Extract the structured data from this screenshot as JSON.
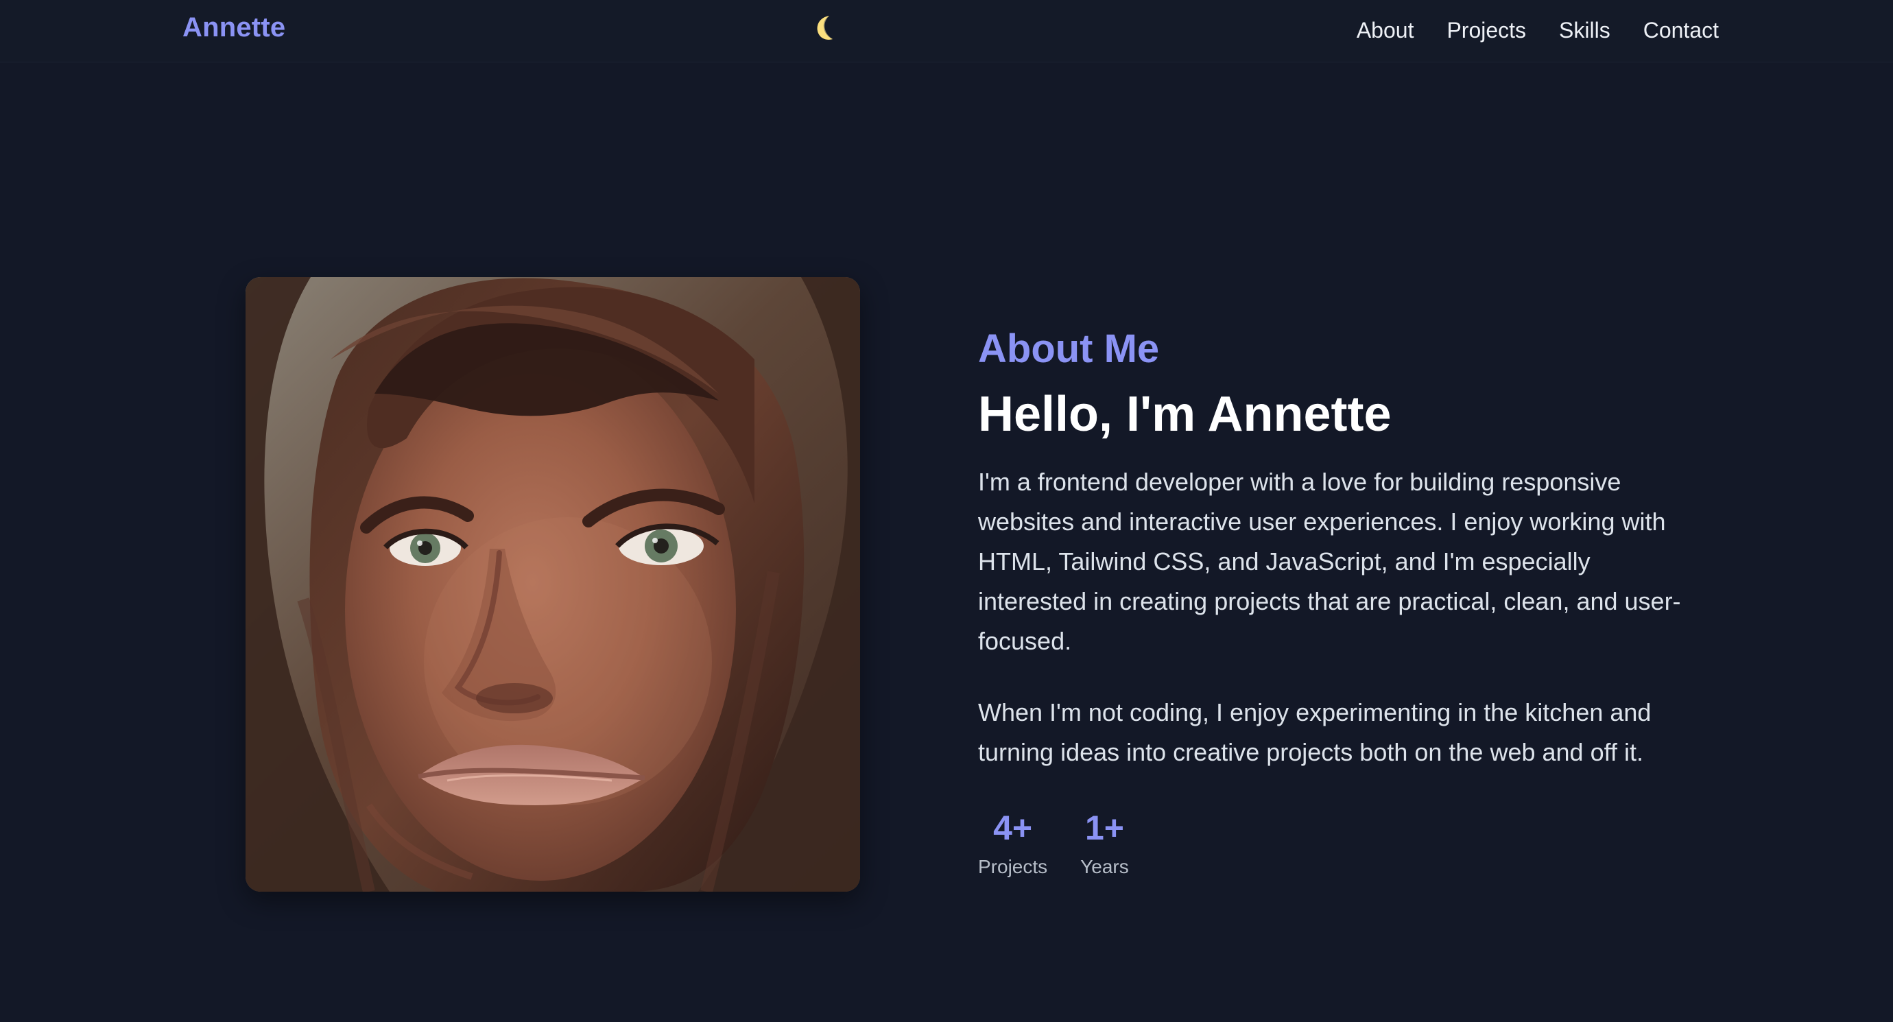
{
  "nav": {
    "brand": "Annette",
    "theme_icon": "moon-icon",
    "links": [
      {
        "label": "About"
      },
      {
        "label": "Projects"
      },
      {
        "label": "Skills"
      },
      {
        "label": "Contact"
      }
    ]
  },
  "about": {
    "section_title": "About Me",
    "headline": "Hello, I'm Annette",
    "paragraphs": [
      "I'm a frontend developer with a love for building responsive websites and interactive user experiences. I enjoy working with HTML, Tailwind CSS, and JavaScript, and I'm especially interested in creating projects that are practical, clean, and user-focused.",
      "When I'm not coding, I enjoy experimenting in the kitchen and turning ideas into creative projects both on the web and off it."
    ],
    "stats": [
      {
        "value": "4+",
        "label": "Projects"
      },
      {
        "value": "1+",
        "label": "Years"
      }
    ]
  },
  "colors": {
    "background": "#131827",
    "accent": "#8b93f4",
    "text": "#eef1f6",
    "muted_text": "#b7bec9"
  }
}
